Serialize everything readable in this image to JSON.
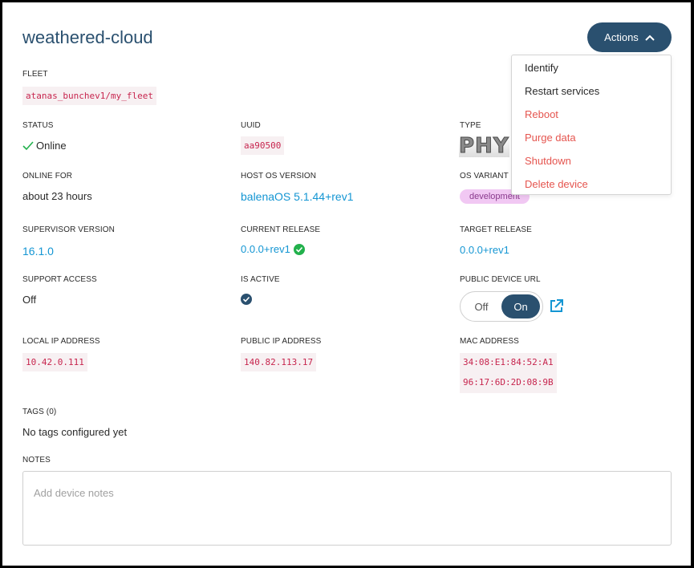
{
  "device": {
    "name": "weathered-cloud"
  },
  "actions": {
    "label": "Actions",
    "menu": [
      "Identify",
      "Restart services",
      "Reboot",
      "Purge data",
      "Shutdown",
      "Delete device"
    ]
  },
  "fields": {
    "fleet": {
      "label": "FLEET",
      "value": "atanas_bunchev1/my_fleet"
    },
    "status": {
      "label": "STATUS",
      "value": "Online"
    },
    "uuid": {
      "label": "UUID",
      "value": "aa90500"
    },
    "type": {
      "label": "TYPE",
      "value": "PHY"
    },
    "online_for": {
      "label": "ONLINE FOR",
      "value": "about 23 hours"
    },
    "host_os": {
      "label": "HOST OS VERSION",
      "value": "balenaOS 5.1.44+rev1"
    },
    "os_variant": {
      "label": "OS VARIANT",
      "value": "development"
    },
    "supervisor": {
      "label": "SUPERVISOR VERSION",
      "value": "16.1.0"
    },
    "current_release": {
      "label": "CURRENT RELEASE",
      "value": "0.0.0+rev1"
    },
    "target_release": {
      "label": "TARGET RELEASE",
      "value": "0.0.0+rev1"
    },
    "support_access": {
      "label": "SUPPORT ACCESS",
      "value": "Off"
    },
    "is_active": {
      "label": "IS ACTIVE"
    },
    "public_url": {
      "label": "PUBLIC DEVICE URL",
      "off": "Off",
      "on": "On"
    },
    "local_ip": {
      "label": "LOCAL IP ADDRESS",
      "value": "10.42.0.111"
    },
    "public_ip": {
      "label": "PUBLIC IP ADDRESS",
      "value": "140.82.113.17"
    },
    "mac": {
      "label": "MAC ADDRESS",
      "values": [
        "34:08:E1:84:52:A1",
        "96:17:6D:2D:08:9B"
      ]
    },
    "tags": {
      "label": "TAGS (0)",
      "value": "No tags configured yet"
    },
    "notes": {
      "label": "NOTES",
      "placeholder": "Add device notes"
    }
  },
  "colors": {
    "primary": "#2a506f",
    "link": "#1496d3",
    "danger": "#e5554f",
    "success": "#22b14c",
    "code": "#c7254e"
  }
}
